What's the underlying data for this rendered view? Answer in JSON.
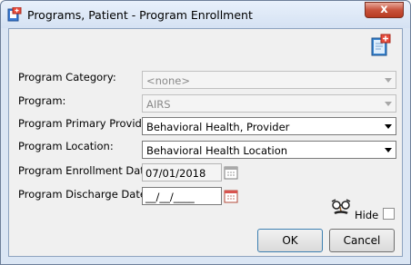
{
  "window": {
    "title": "Programs, Patient - Program Enrollment"
  },
  "icons": {
    "app": "program-enrollment-icon",
    "help": "book-help-icon",
    "hide": "disguise-glasses-icon",
    "calendar": "calendar-icon"
  },
  "form": {
    "category_label": "Program Category:",
    "category_value": "<none>",
    "program_label": "Program:",
    "program_value": "AIRS",
    "provider_label": "Program Primary Provider:",
    "provider_value": "Behavioral Health, Provider",
    "location_label": "Program Location:",
    "location_value": "Behavioral Health Location",
    "enrollment_label": "Program Enrollment Date:",
    "enrollment_value": "07/01/2018",
    "discharge_label": "Program Discharge Date:",
    "discharge_value": "__/__/____",
    "hide_label": "Hide",
    "hide_checked": false
  },
  "buttons": {
    "ok": "OK",
    "cancel": "Cancel",
    "close": "x"
  }
}
